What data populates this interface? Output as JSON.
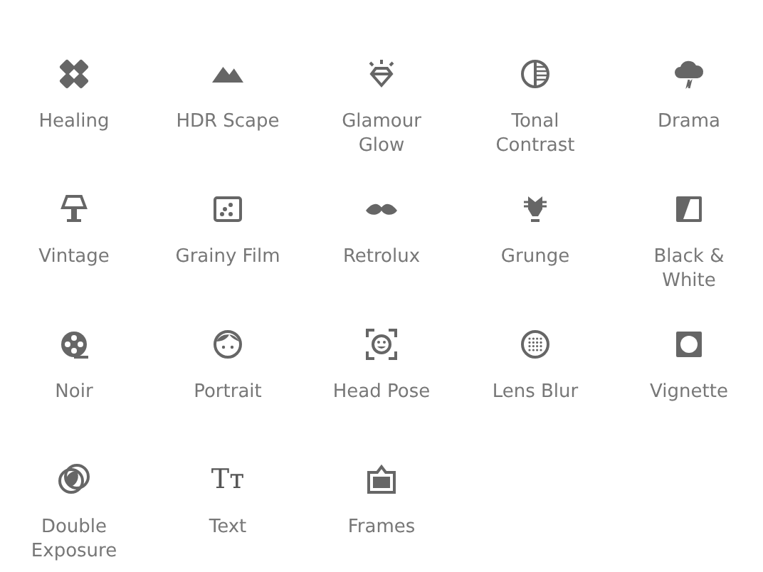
{
  "tools": [
    {
      "kind": "healing",
      "label": "Healing"
    },
    {
      "kind": "hdr",
      "label": "HDR Scape"
    },
    {
      "kind": "glamour",
      "label": "Glamour Glow"
    },
    {
      "kind": "tonal",
      "label": "Tonal Contrast"
    },
    {
      "kind": "drama",
      "label": "Drama"
    },
    {
      "kind": "vintage",
      "label": "Vintage"
    },
    {
      "kind": "grainy",
      "label": "Grainy Film"
    },
    {
      "kind": "retrolux",
      "label": "Retrolux"
    },
    {
      "kind": "grunge",
      "label": "Grunge"
    },
    {
      "kind": "bw",
      "label": "Black & White"
    },
    {
      "kind": "noir",
      "label": "Noir"
    },
    {
      "kind": "portrait",
      "label": "Portrait"
    },
    {
      "kind": "headpose",
      "label": "Head Pose"
    },
    {
      "kind": "lensblur",
      "label": "Lens Blur"
    },
    {
      "kind": "vignette",
      "label": "Vignette"
    },
    {
      "kind": "double",
      "label": "Double Exposure"
    },
    {
      "kind": "text",
      "label": "Text",
      "glyph": "Tᴛ"
    },
    {
      "kind": "frames",
      "label": "Frames"
    }
  ]
}
